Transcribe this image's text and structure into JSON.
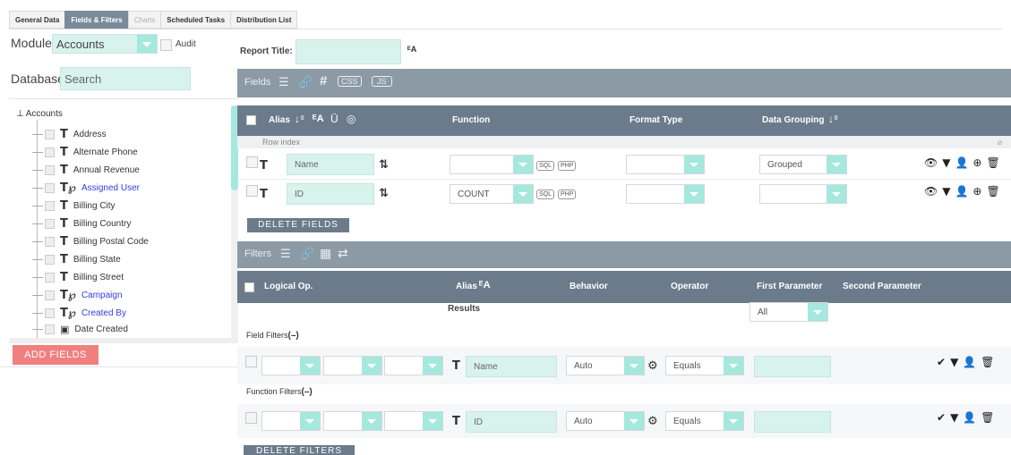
{
  "tabs": [
    {
      "label": "General Data",
      "state": "normal"
    },
    {
      "label": "Fields & Filters",
      "state": "active"
    },
    {
      "label": "Charts",
      "state": "disabled"
    },
    {
      "label": "Scheduled Tasks",
      "state": "normal"
    },
    {
      "label": "Distribution List",
      "state": "normal"
    }
  ],
  "left": {
    "module_label": "Module",
    "module_value": "Accounts",
    "audit_label": "Audit",
    "database_label": "Database",
    "search_placeholder": "Search",
    "tree_root": "Accounts",
    "tree_items": [
      {
        "label": "Address",
        "kind": "field"
      },
      {
        "label": "Alternate Phone",
        "kind": "field"
      },
      {
        "label": "Annual Revenue",
        "kind": "field"
      },
      {
        "label": "Assigned User",
        "kind": "relation"
      },
      {
        "label": "Billing City",
        "kind": "field"
      },
      {
        "label": "Billing Country",
        "kind": "field"
      },
      {
        "label": "Billing Postal Code",
        "kind": "field"
      },
      {
        "label": "Billing State",
        "kind": "field"
      },
      {
        "label": "Billing Street",
        "kind": "field"
      },
      {
        "label": "Campaign",
        "kind": "relation"
      },
      {
        "label": "Created By",
        "kind": "relation"
      },
      {
        "label": "Date Created",
        "kind": "date"
      }
    ],
    "add_fields_label": "ADD FIELDS"
  },
  "report_title_label": "Report Title:",
  "report_title_value": "",
  "fields": {
    "bar_title": "Fields",
    "css_label": "CSS",
    "js_label": "JS",
    "headers": {
      "alias": "Alias",
      "function": "Function",
      "format_type": "Format Type",
      "data_grouping": "Data Grouping"
    },
    "row_index_label": "Row index",
    "rows": [
      {
        "alias": "Name",
        "function": "",
        "format_type": "",
        "grouping": "Grouped"
      },
      {
        "alias": "ID",
        "function": "COUNT",
        "format_type": "",
        "grouping": ""
      }
    ],
    "sql_label": "SQL",
    "php_label": "PHP",
    "delete_label": "DELETE FIELDS"
  },
  "filters": {
    "bar_title": "Filters",
    "headers": {
      "logical_op": "Logical Op.",
      "alias": "Alias",
      "behavior": "Behavior",
      "operator": "Operator",
      "first_param": "First Parameter",
      "second_param": "Second Parameter"
    },
    "results_label": "Results",
    "results_value": "All",
    "field_filters_label": "Field Filters",
    "function_filters_label": "Function Filters",
    "rows": [
      {
        "alias": "Name",
        "behavior": "Auto",
        "operator": "Equals",
        "first": ""
      },
      {
        "alias": "ID",
        "behavior": "Auto",
        "operator": "Equals",
        "first": ""
      }
    ],
    "delete_label": "DELETE FILTERS"
  },
  "colors": {
    "accent": "#a5e8dd",
    "input_bg": "#d8f3ec",
    "header_bar": "#8c9aa6",
    "header_bar_dark": "#6b7b8b",
    "add_button": "#f08080",
    "link": "#3a3ae8"
  }
}
